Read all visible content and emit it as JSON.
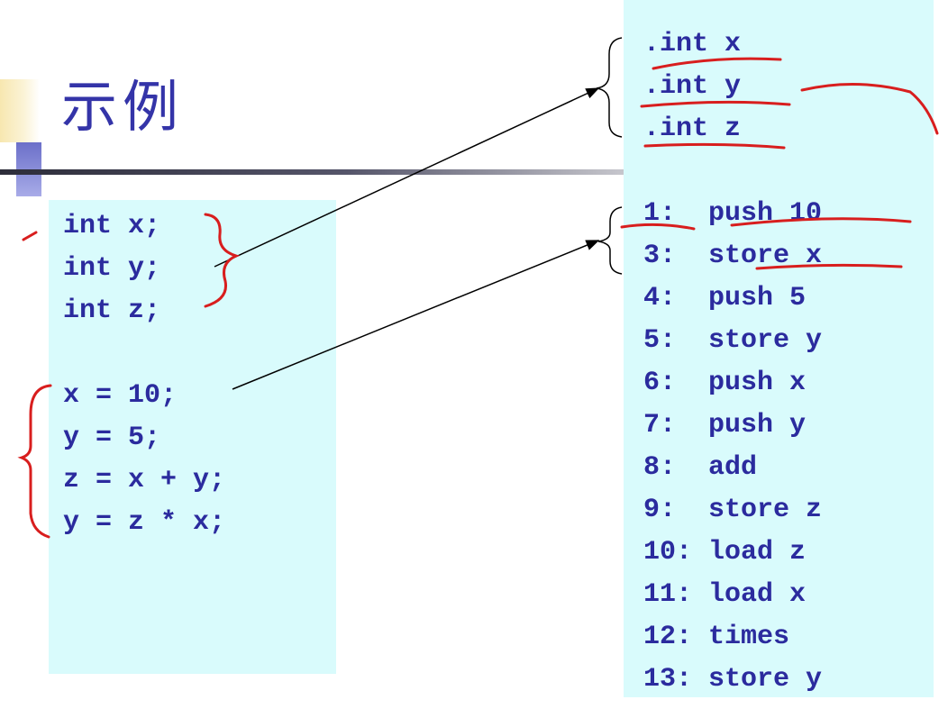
{
  "title": "示例",
  "source_code": [
    "int x;",
    "int y;",
    "int z;",
    "",
    "x = 10;",
    "y = 5;",
    "z = x + y;",
    "y = z * x;"
  ],
  "declarations": [
    ".int x",
    ".int y",
    ".int z"
  ],
  "instructions": [
    "1:  push 10",
    "3:  store x",
    "4:  push 5",
    "5:  store y",
    "6:  push x",
    "7:  push y",
    "8:  add",
    "9:  store z",
    "10: load z",
    "11: load x",
    "12: times",
    "13: store y"
  ],
  "colors": {
    "text": "#2b2b9e",
    "panel": "#d9fbfc",
    "title": "#3434a8",
    "annotation": "#d81e1e"
  }
}
